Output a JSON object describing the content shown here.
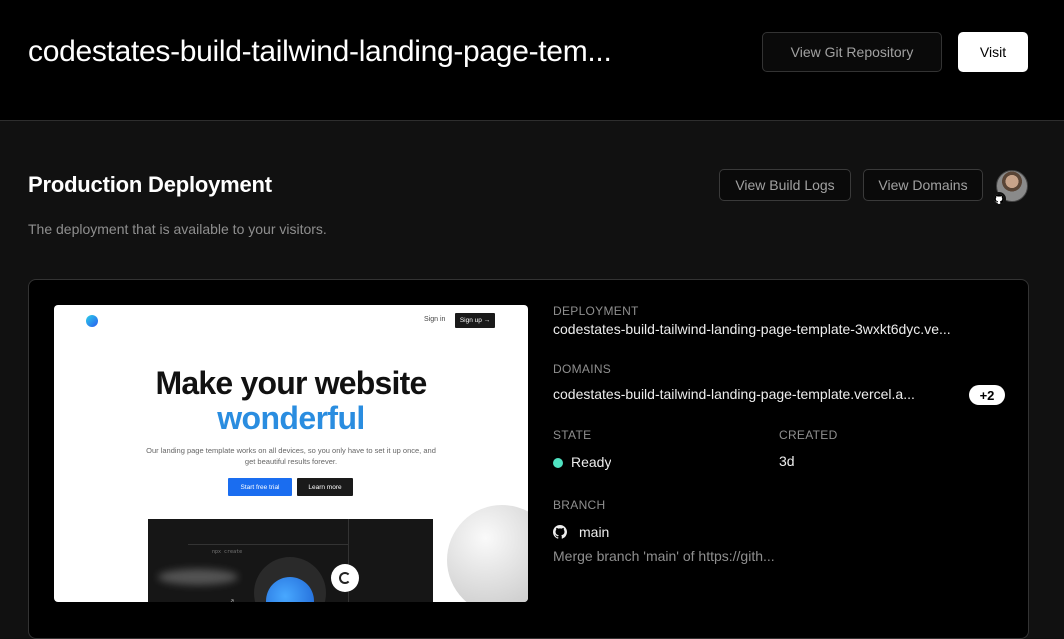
{
  "header": {
    "title": "codestates-build-tailwind-landing-page-tem...",
    "git_label": "View Git Repository",
    "visit_label": "Visit"
  },
  "section": {
    "title": "Production Deployment",
    "subtitle": "The deployment that is available to your visitors.",
    "logs_label": "View Build Logs",
    "domains_label": "View Domains"
  },
  "preview": {
    "signin": "Sign in",
    "signup": "Sign up →",
    "headline1": "Make your website",
    "headline2": "wonderful",
    "paragraph": "Our landing page template works on all devices, so you only have to set it up once, and get beautiful results forever.",
    "primary_cta": "Start free trial",
    "secondary_cta": "Learn more",
    "code_label": "npx create",
    "accent_color": "#2a8de0"
  },
  "deployment": {
    "deployment_label": "DEPLOYMENT",
    "deployment_value": "codestates-build-tailwind-landing-page-template-3wxkt6dyc.ve...",
    "domains_label": "DOMAINS",
    "domains_value": "codestates-build-tailwind-landing-page-template.vercel.a...",
    "domains_extra": "+2",
    "state_label": "STATE",
    "state_value": "Ready",
    "state_color": "#50e3c2",
    "created_label": "CREATED",
    "created_value": "3d",
    "branch_label": "BRANCH",
    "branch_value": "main",
    "commit_message": "Merge branch 'main' of https://gith..."
  }
}
